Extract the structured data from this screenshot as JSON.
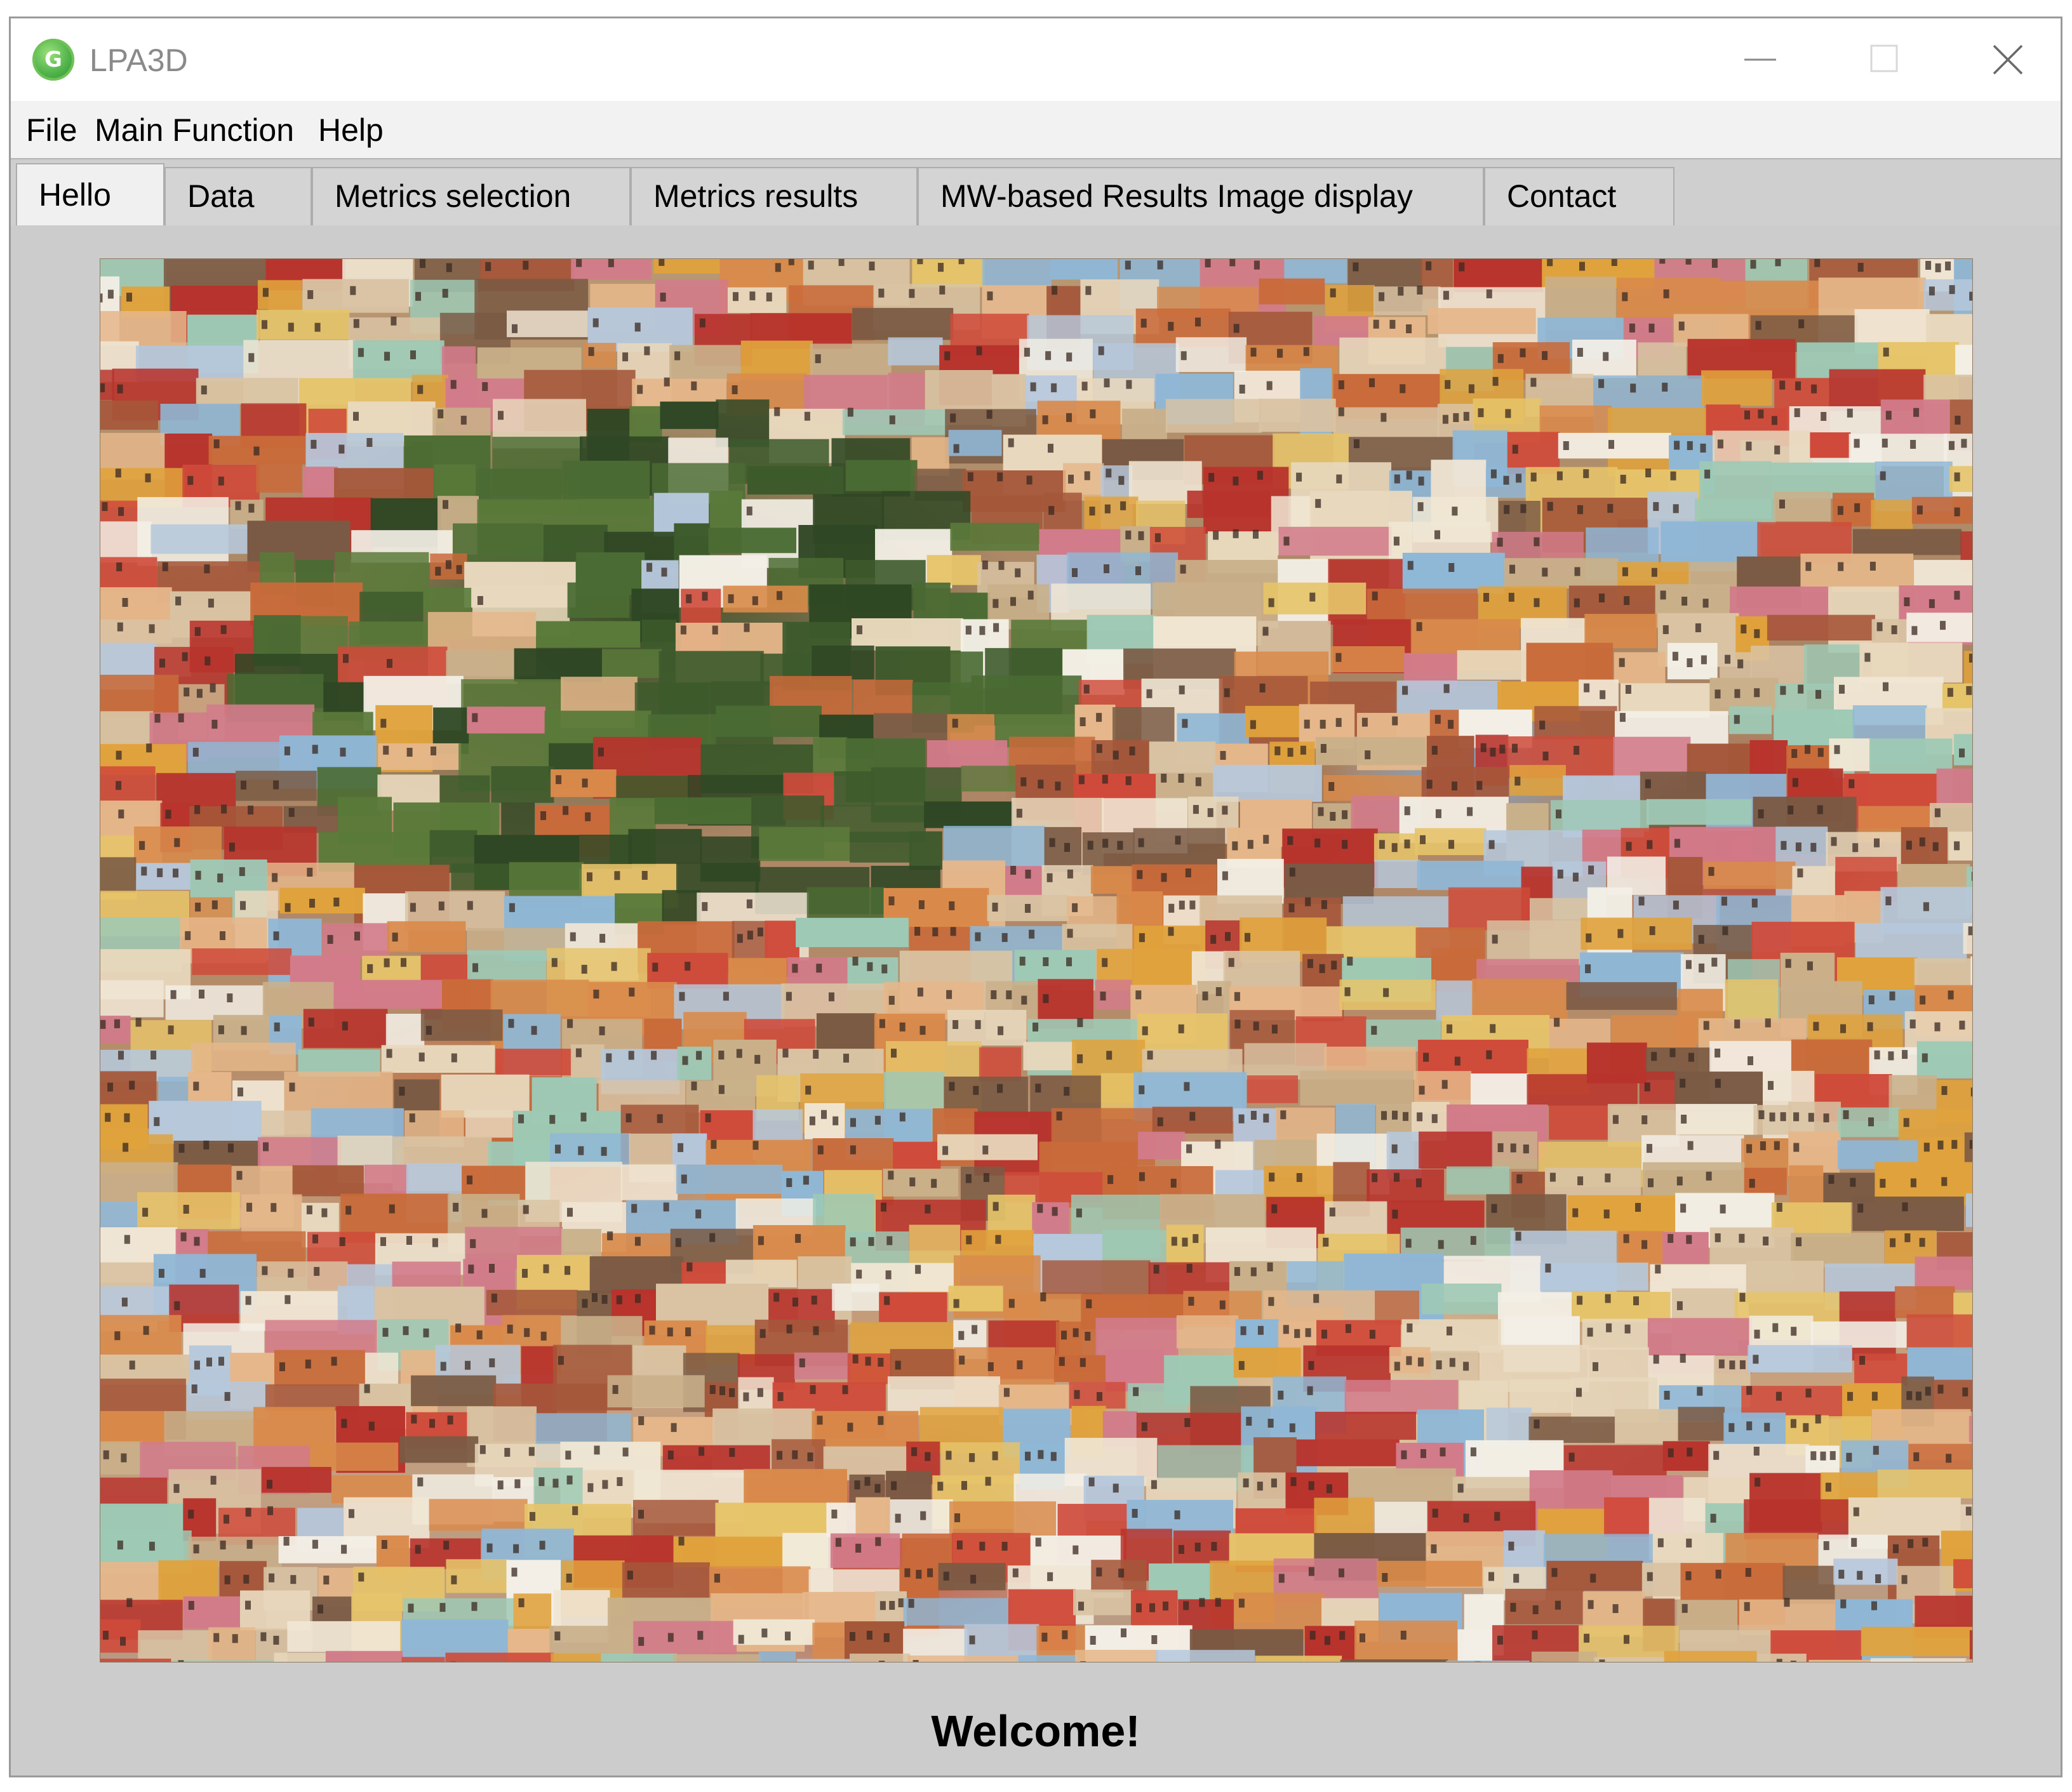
{
  "window": {
    "title": "LPA3D",
    "logo_letter": "G",
    "logo_icon": "app-logo-icon",
    "controls": [
      "minimize-icon",
      "maximize-icon",
      "close-icon"
    ]
  },
  "menu": {
    "file": "File",
    "main_function": "Main Function",
    "help": "Help"
  },
  "tabs": [
    {
      "label": "Hello",
      "active": true
    },
    {
      "label": "Data",
      "active": false
    },
    {
      "label": "Metrics selection",
      "active": false
    },
    {
      "label": "Metrics results",
      "active": false
    },
    {
      "label": "MW-based Results Image display",
      "active": false
    },
    {
      "label": "Contact",
      "active": false
    }
  ],
  "hello": {
    "image": "colorful-hillside-city-photo",
    "welcome_text": "Welcome!"
  },
  "colors": {
    "window_bg": "#cccccc",
    "titlebar_bg": "#ffffff",
    "menubar_bg": "#f2f2f2",
    "active_tab_bg": "#f0f0f0",
    "logo_green": "#4fb34a"
  }
}
